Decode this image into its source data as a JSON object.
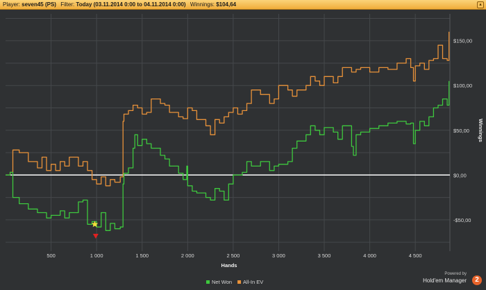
{
  "header": {
    "player_label": "Player:",
    "player_value": "seven45 (PS)",
    "filter_label": "Filter:",
    "filter_value": "Today (03.11.2014 0:00 to 04.11.2014 0:00)",
    "winnings_label": "Winnings:",
    "winnings_value": "$104,64"
  },
  "brand": {
    "powered_by": "Powered by",
    "name": "Hold'em Manager",
    "badge": "2"
  },
  "colors": {
    "net_won": "#3ec83e",
    "all_in_ev": "#e9923a",
    "zero_line": "#ffffff",
    "grid": "#45484b"
  },
  "chart_data": {
    "type": "line",
    "xlabel": "Hands",
    "ylabel": "Winnings",
    "xlim": [
      0,
      4880
    ],
    "ylim": [
      -85,
      180
    ],
    "x_ticks": [
      500,
      1000,
      1500,
      2000,
      2500,
      3000,
      3500,
      4000,
      4500
    ],
    "x_tick_labels": [
      "500",
      "1 000",
      "1 500",
      "2 000",
      "2 500",
      "3 000",
      "3 500",
      "4 000",
      "4 500"
    ],
    "y_ticks": [
      -50,
      0,
      50,
      100,
      150
    ],
    "y_tick_labels": [
      "-$50,00",
      "$0,00",
      "$50,00",
      "$100,00",
      "$150,00"
    ],
    "grid": true,
    "legend_position": "bottom-center",
    "series": [
      {
        "name": "Net Won",
        "color": "#3ec83e",
        "x": [
          0,
          50,
          80,
          150,
          250,
          350,
          450,
          500,
          600,
          650,
          700,
          800,
          850,
          900,
          950,
          1000,
          1050,
          1100,
          1150,
          1200,
          1260,
          1290,
          1300,
          1350,
          1400,
          1420,
          1450,
          1500,
          1550,
          1600,
          1700,
          1750,
          1800,
          1900,
          1950,
          1990,
          2000,
          2050,
          2100,
          2200,
          2250,
          2300,
          2350,
          2400,
          2450,
          2500,
          2550,
          2600,
          2650,
          2700,
          2800,
          2900,
          2950,
          3000,
          3100,
          3150,
          3200,
          3300,
          3350,
          3400,
          3450,
          3500,
          3600,
          3650,
          3700,
          3800,
          3820,
          3850,
          3900,
          4000,
          4100,
          4200,
          4300,
          4400,
          4450,
          4480,
          4500,
          4550,
          4600,
          4650,
          4700,
          4750,
          4800,
          4850,
          4870
        ],
        "y": [
          0,
          3,
          -25,
          -32,
          -38,
          -42,
          -48,
          -45,
          -40,
          -48,
          -42,
          -30,
          -28,
          -55,
          -52,
          -58,
          -42,
          -62,
          -54,
          -60,
          -58,
          -10,
          2,
          8,
          30,
          45,
          33,
          40,
          35,
          30,
          22,
          18,
          10,
          2,
          -5,
          10,
          -12,
          -18,
          -20,
          -25,
          -28,
          -15,
          -18,
          -28,
          -10,
          0,
          0,
          3,
          15,
          10,
          15,
          5,
          10,
          12,
          15,
          30,
          38,
          45,
          55,
          50,
          45,
          53,
          48,
          40,
          55,
          32,
          22,
          45,
          48,
          52,
          55,
          58,
          60,
          57,
          58,
          35,
          50,
          60,
          55,
          65,
          75,
          78,
          85,
          78,
          105
        ]
      },
      {
        "name": "All-In EV",
        "color": "#e9923a",
        "x": [
          0,
          50,
          80,
          150,
          250,
          350,
          400,
          450,
          500,
          550,
          600,
          650,
          700,
          800,
          850,
          900,
          950,
          1000,
          1050,
          1100,
          1150,
          1200,
          1260,
          1290,
          1300,
          1350,
          1400,
          1450,
          1500,
          1550,
          1600,
          1700,
          1750,
          1800,
          1900,
          1950,
          2000,
          2050,
          2100,
          2200,
          2250,
          2300,
          2350,
          2400,
          2450,
          2500,
          2550,
          2600,
          2650,
          2700,
          2800,
          2900,
          2950,
          3000,
          3100,
          3150,
          3200,
          3300,
          3350,
          3400,
          3450,
          3500,
          3600,
          3650,
          3700,
          3800,
          3850,
          3900,
          4000,
          4100,
          4200,
          4300,
          4400,
          4450,
          4480,
          4500,
          4550,
          4600,
          4650,
          4700,
          4750,
          4800,
          4850,
          4870
        ],
        "y": [
          0,
          3,
          28,
          25,
          15,
          8,
          20,
          5,
          12,
          5,
          15,
          10,
          20,
          10,
          15,
          5,
          -5,
          -10,
          -2,
          -12,
          -5,
          -8,
          -2,
          60,
          68,
          72,
          78,
          75,
          68,
          70,
          85,
          80,
          78,
          70,
          65,
          63,
          75,
          72,
          62,
          55,
          45,
          62,
          58,
          65,
          70,
          75,
          68,
          72,
          80,
          95,
          90,
          80,
          85,
          100,
          95,
          88,
          95,
          100,
          110,
          105,
          100,
          110,
          103,
          110,
          120,
          115,
          118,
          120,
          115,
          120,
          118,
          125,
          130,
          120,
          105,
          122,
          125,
          118,
          128,
          130,
          145,
          130,
          128,
          160
        ]
      }
    ],
    "markers": [
      {
        "label": "star",
        "x": 980,
        "y": -55,
        "color": "#f3e03a"
      },
      {
        "label": "triangle-down",
        "x": 990,
        "y": -68,
        "color": "#e02020"
      }
    ]
  }
}
